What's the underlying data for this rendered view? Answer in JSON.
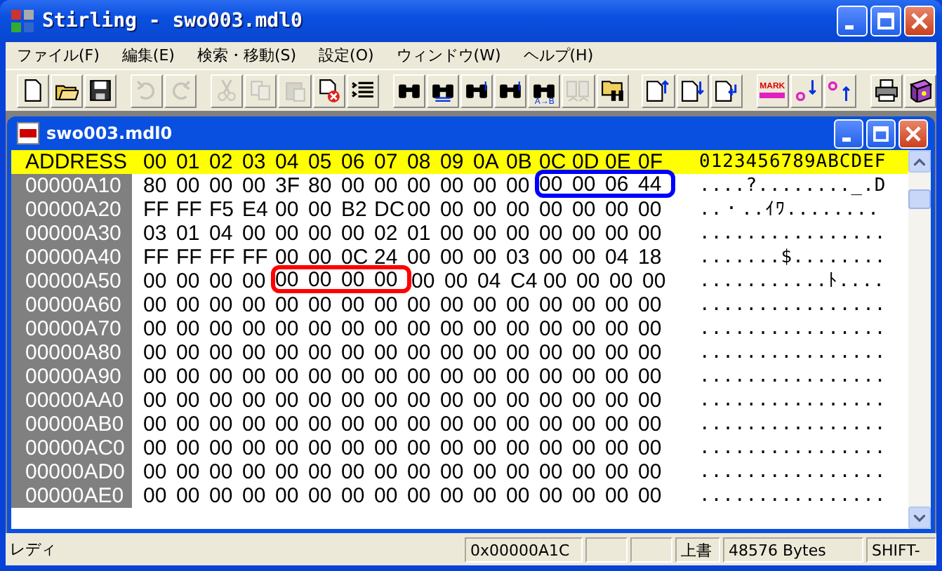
{
  "window": {
    "title": "Stirling - swo003.mdl0"
  },
  "menu": [
    {
      "label": "ファイル(F)"
    },
    {
      "label": "編集(E)"
    },
    {
      "label": "検索・移動(S)"
    },
    {
      "label": "設定(O)"
    },
    {
      "label": "ウィンドウ(W)"
    },
    {
      "label": "ヘルプ(H)"
    }
  ],
  "toolbar": {
    "groups": [
      [
        {
          "kind": "new",
          "disabled": false
        },
        {
          "kind": "open",
          "disabled": false
        },
        {
          "kind": "save",
          "disabled": false
        }
      ],
      [
        {
          "kind": "undo",
          "disabled": true
        },
        {
          "kind": "redo",
          "disabled": true
        }
      ],
      [
        {
          "kind": "cut",
          "disabled": true
        },
        {
          "kind": "copy",
          "disabled": true
        },
        {
          "kind": "paste",
          "disabled": true
        },
        {
          "kind": "delete",
          "disabled": false
        },
        {
          "kind": "list",
          "disabled": false
        }
      ],
      [
        {
          "kind": "find",
          "disabled": false
        },
        {
          "kind": "replace",
          "disabled": false
        },
        {
          "kind": "find-next",
          "disabled": false
        },
        {
          "kind": "find-prev",
          "disabled": false
        },
        {
          "kind": "find-range",
          "label": "A→B",
          "disabled": false
        },
        {
          "kind": "compare",
          "disabled": true
        },
        {
          "kind": "find-folder",
          "disabled": false
        }
      ],
      [
        {
          "kind": "page-up",
          "disabled": false
        },
        {
          "kind": "page-down",
          "disabled": false
        },
        {
          "kind": "page-return",
          "disabled": false
        }
      ],
      [
        {
          "kind": "mark",
          "label": "MARK",
          "disabled": false
        },
        {
          "kind": "mark-next",
          "disabled": false
        },
        {
          "kind": "mark-prev",
          "disabled": false
        }
      ],
      [
        {
          "kind": "print",
          "disabled": false
        },
        {
          "kind": "help",
          "disabled": false
        }
      ]
    ]
  },
  "document": {
    "title": "swo003.mdl0",
    "header": {
      "address": "ADDRESS",
      "columns": [
        "00",
        "01",
        "02",
        "03",
        "04",
        "05",
        "06",
        "07",
        "08",
        "09",
        "0A",
        "0B",
        "0C",
        "0D",
        "0E",
        "0F"
      ],
      "ascii": "0123456789ABCDEF"
    },
    "rows": [
      {
        "address": "00000A10",
        "segments": [
          {
            "bytes": [
              "80",
              "00",
              "00",
              "00",
              "3F",
              "80",
              "00",
              "00",
              "00",
              "00",
              "00",
              "00"
            ]
          },
          {
            "bytes": [
              "00",
              "00",
              "06",
              "44"
            ],
            "color": "#0000ff"
          }
        ],
        "ascii": "....?........_.D"
      },
      {
        "address": "00000A20",
        "bytes": [
          "FF",
          "FF",
          "F5",
          "E4",
          "00",
          "00",
          "B2",
          "DC",
          "00",
          "00",
          "00",
          "00",
          "00",
          "00",
          "00",
          "00"
        ],
        "ascii": "..・..ｲﾜ........"
      },
      {
        "address": "00000A30",
        "bytes": [
          "03",
          "01",
          "04",
          "00",
          "00",
          "00",
          "00",
          "02",
          "01",
          "00",
          "00",
          "00",
          "00",
          "00",
          "00",
          "00"
        ],
        "ascii": "................"
      },
      {
        "address": "00000A40",
        "bytes": [
          "FF",
          "FF",
          "FF",
          "FF",
          "00",
          "00",
          "0C",
          "24",
          "00",
          "00",
          "00",
          "03",
          "00",
          "00",
          "04",
          "18"
        ],
        "ascii": ".......$........"
      },
      {
        "address": "00000A50",
        "segments": [
          {
            "bytes": [
              "00",
              "00",
              "00",
              "00"
            ]
          },
          {
            "bytes": [
              "00",
              "00",
              "00",
              "00"
            ],
            "color": "#ff0000"
          },
          {
            "bytes": [
              "00",
              "00",
              "04",
              "C4",
              "00",
              "00",
              "00",
              "00"
            ]
          }
        ],
        "ascii": "...........ﾄ...."
      },
      {
        "address": "00000A60",
        "bytes": [
          "00",
          "00",
          "00",
          "00",
          "00",
          "00",
          "00",
          "00",
          "00",
          "00",
          "00",
          "00",
          "00",
          "00",
          "00",
          "00"
        ],
        "ascii": "................"
      },
      {
        "address": "00000A70",
        "bytes": [
          "00",
          "00",
          "00",
          "00",
          "00",
          "00",
          "00",
          "00",
          "00",
          "00",
          "00",
          "00",
          "00",
          "00",
          "00",
          "00"
        ],
        "ascii": "................"
      },
      {
        "address": "00000A80",
        "bytes": [
          "00",
          "00",
          "00",
          "00",
          "00",
          "00",
          "00",
          "00",
          "00",
          "00",
          "00",
          "00",
          "00",
          "00",
          "00",
          "00"
        ],
        "ascii": "................"
      },
      {
        "address": "00000A90",
        "bytes": [
          "00",
          "00",
          "00",
          "00",
          "00",
          "00",
          "00",
          "00",
          "00",
          "00",
          "00",
          "00",
          "00",
          "00",
          "00",
          "00"
        ],
        "ascii": "................"
      },
      {
        "address": "00000AA0",
        "bytes": [
          "00",
          "00",
          "00",
          "00",
          "00",
          "00",
          "00",
          "00",
          "00",
          "00",
          "00",
          "00",
          "00",
          "00",
          "00",
          "00"
        ],
        "ascii": "................"
      },
      {
        "address": "00000AB0",
        "bytes": [
          "00",
          "00",
          "00",
          "00",
          "00",
          "00",
          "00",
          "00",
          "00",
          "00",
          "00",
          "00",
          "00",
          "00",
          "00",
          "00"
        ],
        "ascii": "................"
      },
      {
        "address": "00000AC0",
        "bytes": [
          "00",
          "00",
          "00",
          "00",
          "00",
          "00",
          "00",
          "00",
          "00",
          "00",
          "00",
          "00",
          "00",
          "00",
          "00",
          "00"
        ],
        "ascii": "................"
      },
      {
        "address": "00000AD0",
        "bytes": [
          "00",
          "00",
          "00",
          "00",
          "00",
          "00",
          "00",
          "00",
          "00",
          "00",
          "00",
          "00",
          "00",
          "00",
          "00",
          "00"
        ],
        "ascii": "................"
      },
      {
        "address": "00000AE0",
        "bytes": [
          "00",
          "00",
          "00",
          "00",
          "00",
          "00",
          "00",
          "00",
          "00",
          "00",
          "00",
          "00",
          "00",
          "00",
          "00",
          "00"
        ],
        "ascii": "................"
      }
    ]
  },
  "status_bar": {
    "message": "レディ",
    "offset": "0x00000A1C",
    "mode": "上書",
    "size": "48576 Bytes",
    "keys": "SHIFT-"
  }
}
